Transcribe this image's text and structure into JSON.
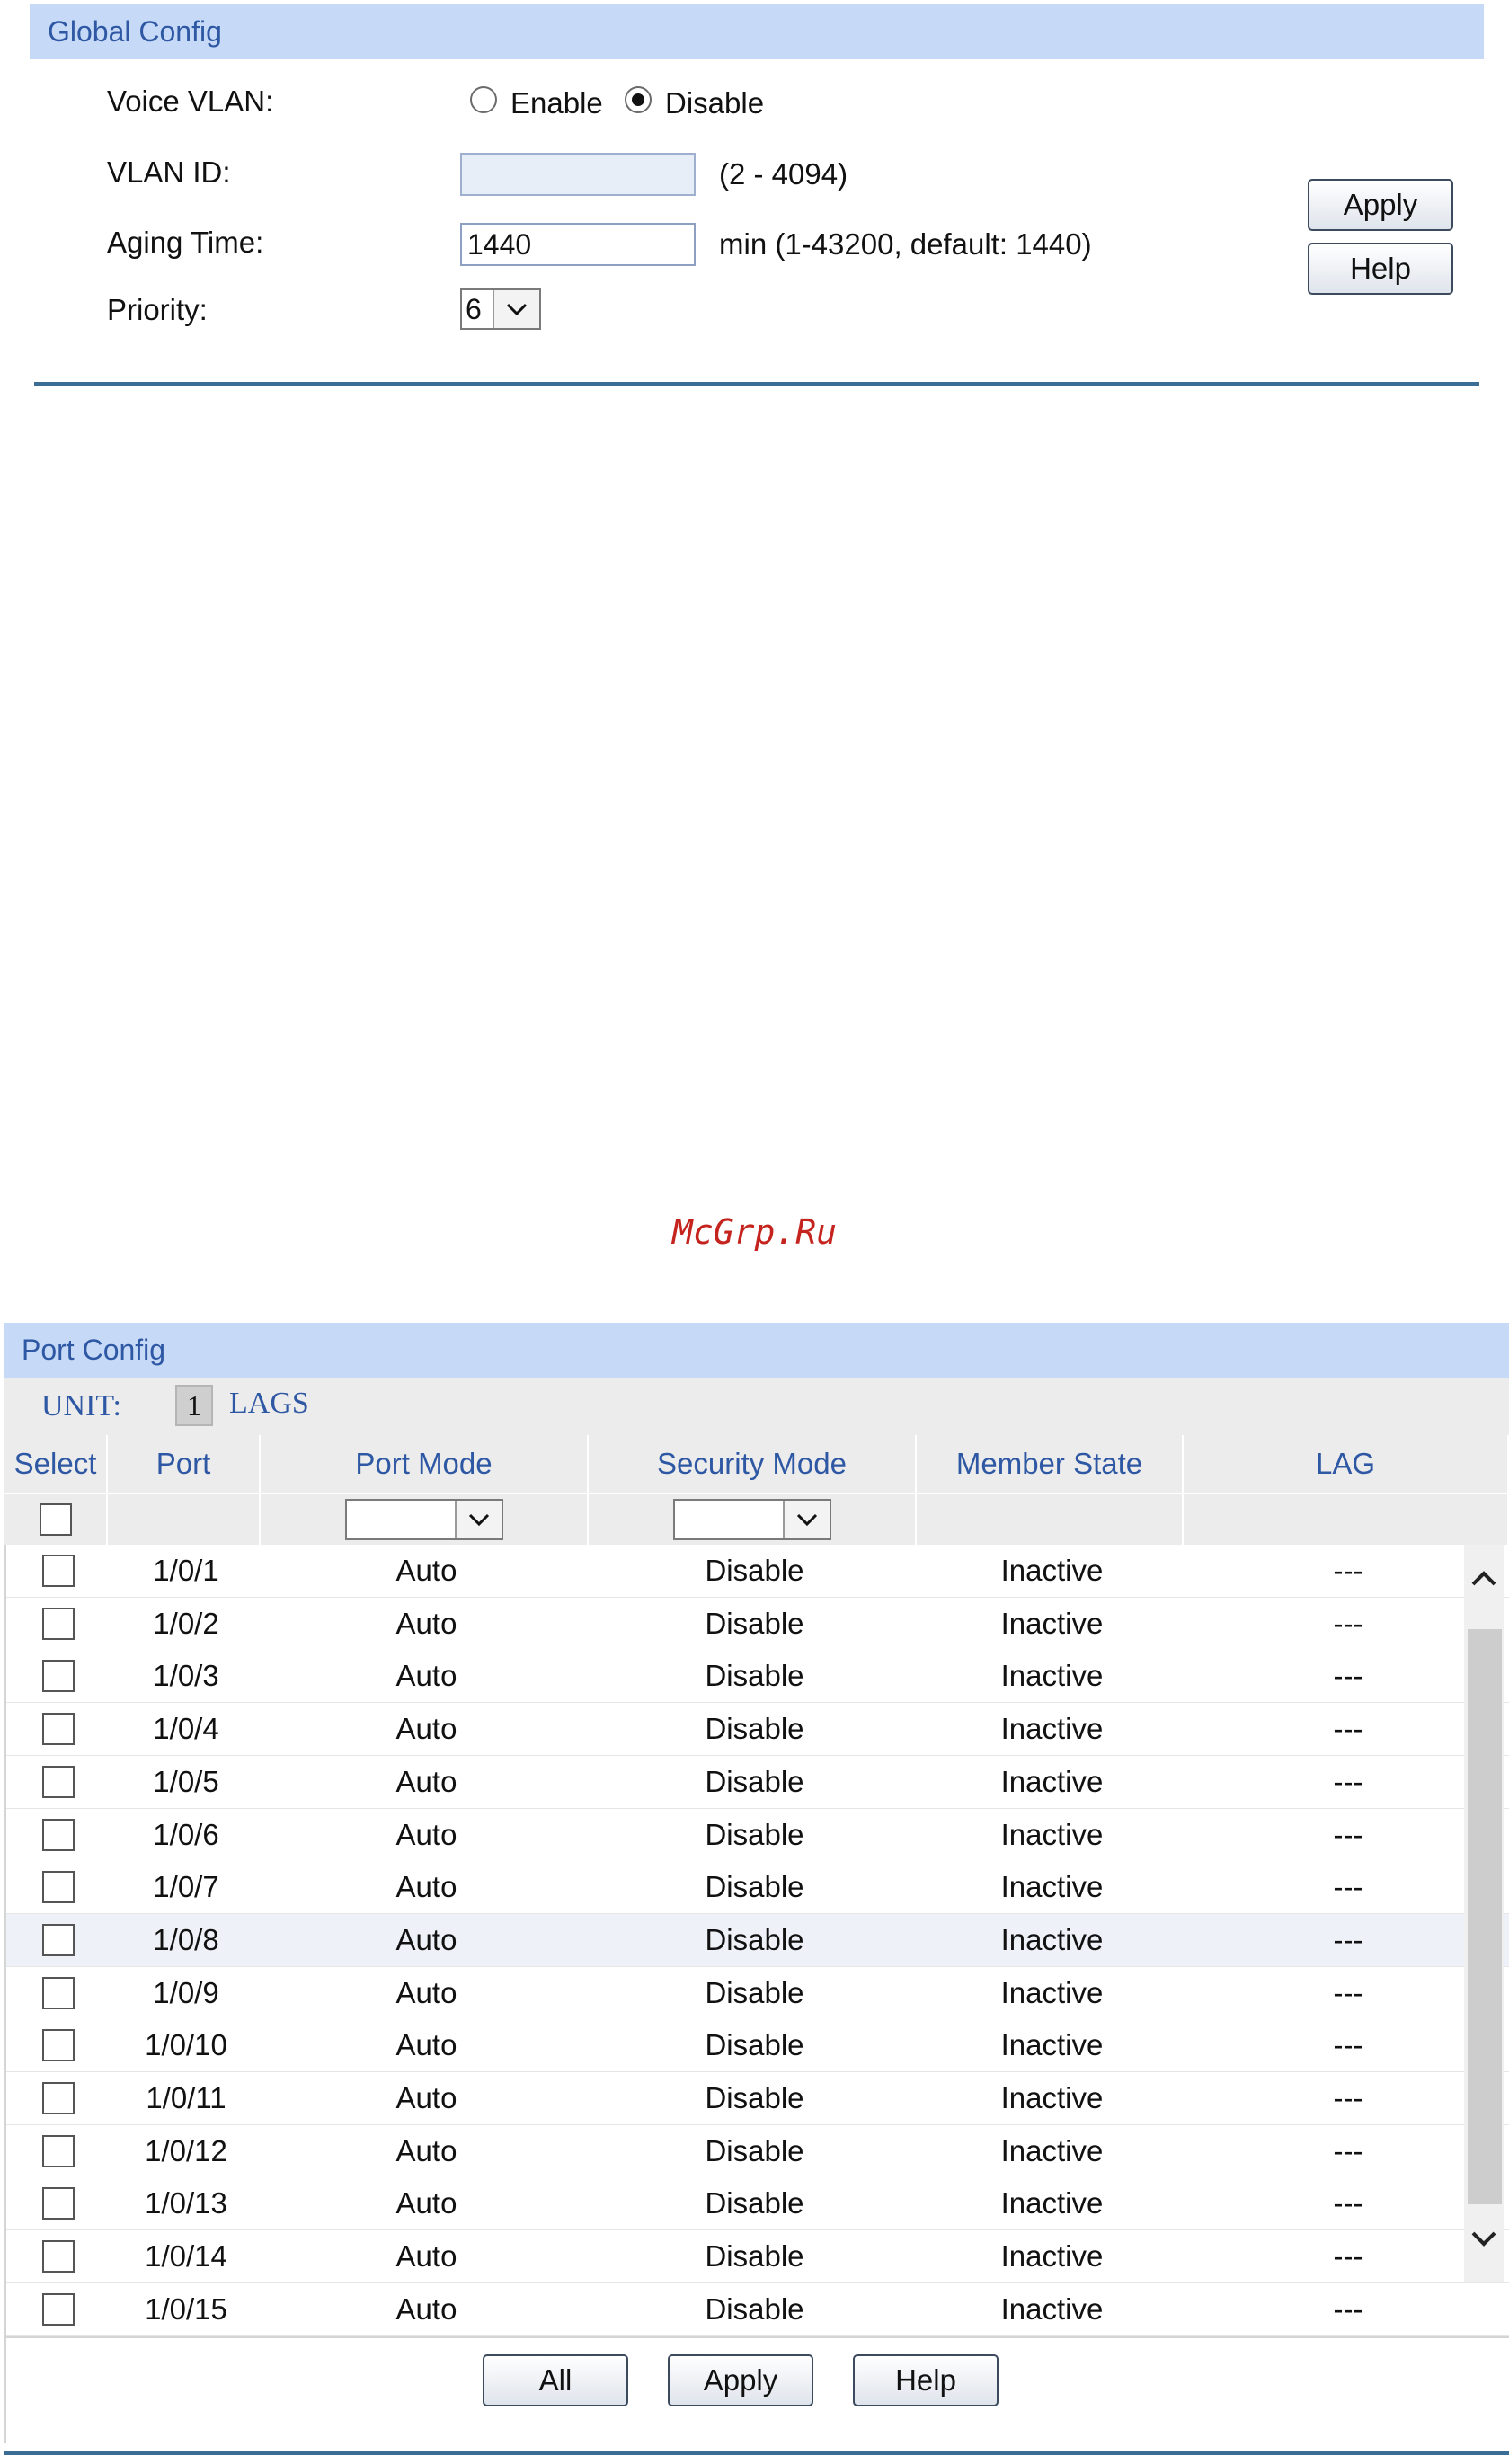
{
  "global_config": {
    "title": "Global Config",
    "voice_vlan_label": "Voice VLAN:",
    "enable_label": "Enable",
    "disable_label": "Disable",
    "voice_vlan_selected": "Disable",
    "vlan_id_label": "VLAN ID:",
    "vlan_id_value": "",
    "vlan_id_hint": "(2 - 4094)",
    "aging_time_label": "Aging Time:",
    "aging_time_value": "1440",
    "aging_time_hint": "min (1-43200, default: 1440)",
    "priority_label": "Priority:",
    "priority_value": "6",
    "apply_label": "Apply",
    "help_label": "Help"
  },
  "watermark": "McGrp.Ru",
  "port_config": {
    "title": "Port Config",
    "unit_label": "UNIT:",
    "unit_value": "1",
    "lags_label": "LAGS",
    "columns": [
      "Select",
      "Port",
      "Port Mode",
      "Security Mode",
      "Member State",
      "LAG"
    ],
    "rows": [
      {
        "port": "1/0/1",
        "mode": "Auto",
        "security": "Disable",
        "state": "Inactive",
        "lag": "---"
      },
      {
        "port": "1/0/2",
        "mode": "Auto",
        "security": "Disable",
        "state": "Inactive",
        "lag": "---"
      },
      {
        "port": "1/0/3",
        "mode": "Auto",
        "security": "Disable",
        "state": "Inactive",
        "lag": "---"
      },
      {
        "port": "1/0/4",
        "mode": "Auto",
        "security": "Disable",
        "state": "Inactive",
        "lag": "---"
      },
      {
        "port": "1/0/5",
        "mode": "Auto",
        "security": "Disable",
        "state": "Inactive",
        "lag": "---"
      },
      {
        "port": "1/0/6",
        "mode": "Auto",
        "security": "Disable",
        "state": "Inactive",
        "lag": "---"
      },
      {
        "port": "1/0/7",
        "mode": "Auto",
        "security": "Disable",
        "state": "Inactive",
        "lag": "---"
      },
      {
        "port": "1/0/8",
        "mode": "Auto",
        "security": "Disable",
        "state": "Inactive",
        "lag": "---"
      },
      {
        "port": "1/0/9",
        "mode": "Auto",
        "security": "Disable",
        "state": "Inactive",
        "lag": "---"
      },
      {
        "port": "1/0/10",
        "mode": "Auto",
        "security": "Disable",
        "state": "Inactive",
        "lag": "---"
      },
      {
        "port": "1/0/11",
        "mode": "Auto",
        "security": "Disable",
        "state": "Inactive",
        "lag": "---"
      },
      {
        "port": "1/0/12",
        "mode": "Auto",
        "security": "Disable",
        "state": "Inactive",
        "lag": "---"
      },
      {
        "port": "1/0/13",
        "mode": "Auto",
        "security": "Disable",
        "state": "Inactive",
        "lag": "---"
      },
      {
        "port": "1/0/14",
        "mode": "Auto",
        "security": "Disable",
        "state": "Inactive",
        "lag": "---"
      },
      {
        "port": "1/0/15",
        "mode": "Auto",
        "security": "Disable",
        "state": "Inactive",
        "lag": "---"
      }
    ],
    "highlighted_row": 7,
    "all_label": "All",
    "apply_label": "Apply",
    "help_label": "Help"
  }
}
